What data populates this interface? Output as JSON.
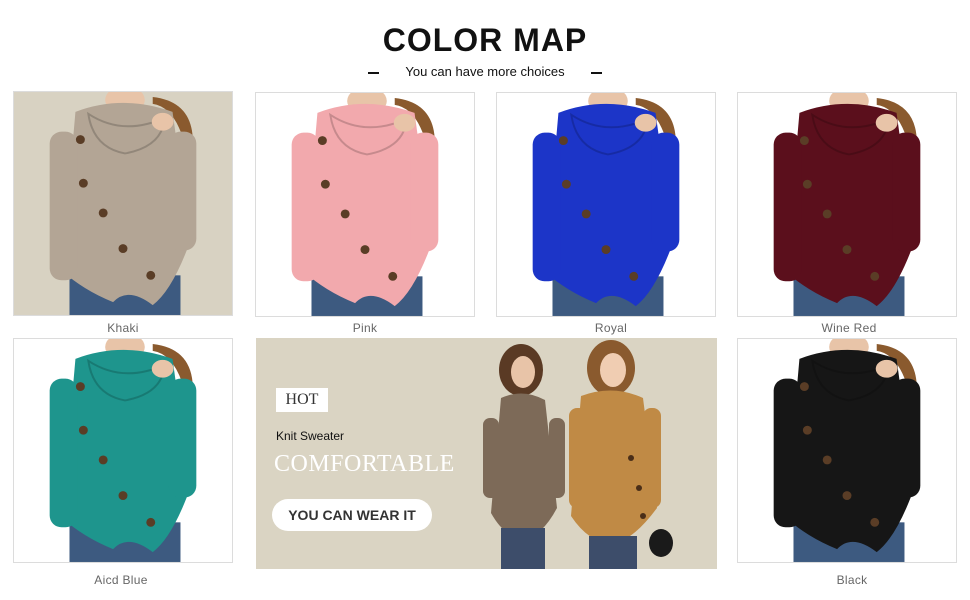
{
  "header": {
    "title": "COLOR MAP",
    "subtitle": "You can have more choices"
  },
  "swatches": [
    {
      "label": "Khaki",
      "color": "#b3a595",
      "bg": "#d8d2c2"
    },
    {
      "label": "Pink",
      "color": "#f2a9ad",
      "bg": "#ffffff"
    },
    {
      "label": "Royal",
      "color": "#1c35c8",
      "bg": "#ffffff"
    },
    {
      "label": "Wine Red",
      "color": "#5b0f1c",
      "bg": "#ffffff"
    },
    {
      "label": "Aicd Blue",
      "color": "#1e958d",
      "bg": "#ffffff"
    },
    {
      "label": "Black",
      "color": "#161616",
      "bg": "#ffffff"
    }
  ],
  "banner": {
    "hot": "HOT",
    "subtitle": "Knit Sweater",
    "headline": "COMFORTABLE",
    "button": "YOU CAN WEAR IT",
    "background": "#dad4c3"
  },
  "colors": {
    "denim": "#3d5a80",
    "skin": "#e8c4a8",
    "hair": "#8a5a2e",
    "button": "#5a3d26"
  }
}
